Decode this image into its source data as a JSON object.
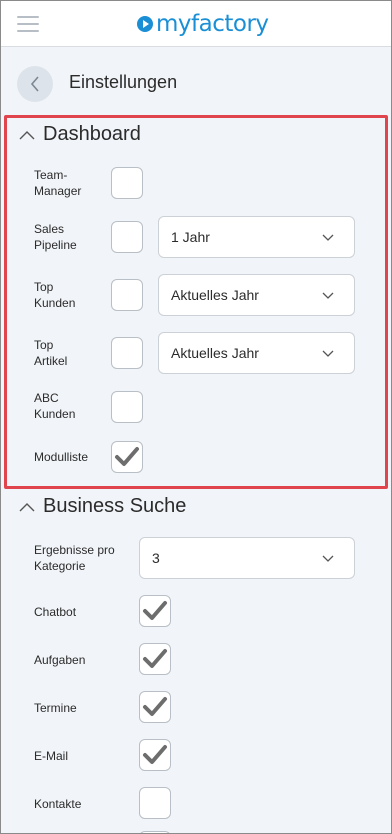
{
  "header": {
    "logo_text": "myfactory",
    "brand_color": "#1a8fd6",
    "menu_icon": "hamburger-icon"
  },
  "titlebar": {
    "title": "Einstellungen",
    "back_icon": "chevron-left-icon"
  },
  "dashboard": {
    "title": "Dashboard",
    "rows": [
      {
        "label": "Team-\nManager",
        "checked": false
      },
      {
        "label": "Sales\nPipeline",
        "checked": false,
        "select": "1 Jahr"
      },
      {
        "label": "Top\nKunden",
        "checked": false,
        "select": "Aktuelles Jahr"
      },
      {
        "label": "Top\nArtikel",
        "checked": false,
        "select": "Aktuelles Jahr"
      },
      {
        "label": "ABC\nKunden",
        "checked": false
      },
      {
        "label": "Modulliste",
        "checked": true
      }
    ]
  },
  "business_search": {
    "title": "Business Suche",
    "results_label": "Ergebnisse pro\nKategorie",
    "results_value": "3",
    "rows": [
      {
        "label": "Chatbot",
        "checked": true
      },
      {
        "label": "Aufgaben",
        "checked": true
      },
      {
        "label": "Termine",
        "checked": true
      },
      {
        "label": "E-Mail",
        "checked": true
      },
      {
        "label": "Kontakte",
        "checked": false
      }
    ]
  },
  "highlight_color": "#e0454d"
}
